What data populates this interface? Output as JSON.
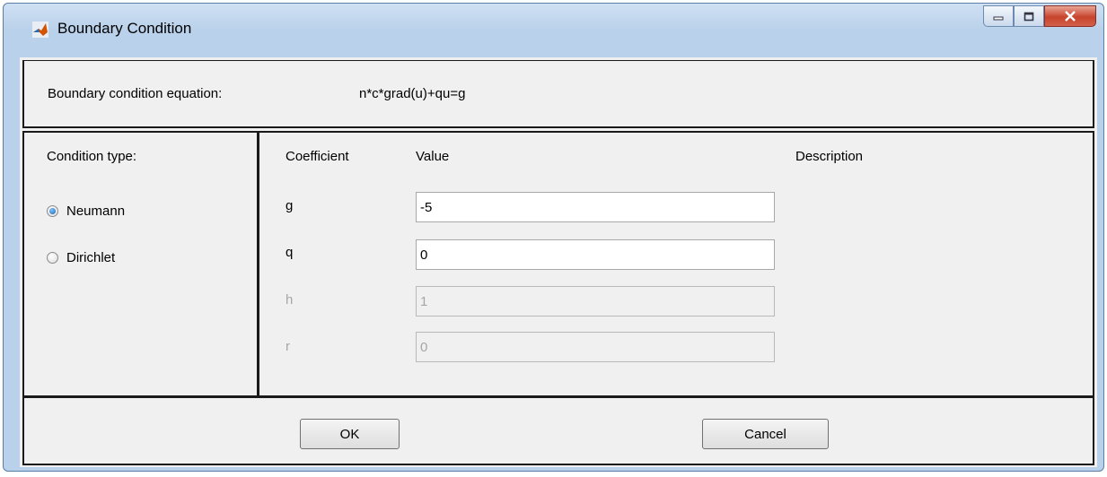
{
  "window": {
    "title": "Boundary Condition"
  },
  "equation": {
    "label": "Boundary condition equation:",
    "value": "n*c*grad(u)+qu=g"
  },
  "condition": {
    "label": "Condition type:",
    "options": [
      {
        "label": "Neumann",
        "selected": true
      },
      {
        "label": "Dirichlet",
        "selected": false
      }
    ]
  },
  "coefficients": {
    "headers": {
      "coefficient": "Coefficient",
      "value": "Value",
      "description": "Description"
    },
    "rows": [
      {
        "name": "g",
        "value": "-5",
        "enabled": true
      },
      {
        "name": "q",
        "value": "0",
        "enabled": true
      },
      {
        "name": "h",
        "value": "1",
        "enabled": false
      },
      {
        "name": "r",
        "value": "0",
        "enabled": false
      }
    ]
  },
  "buttons": {
    "ok": "OK",
    "cancel": "Cancel"
  },
  "icons": {
    "app": "matlab-icon",
    "minimize": "minimize-icon",
    "maximize": "maximize-icon",
    "close": "close-icon"
  }
}
